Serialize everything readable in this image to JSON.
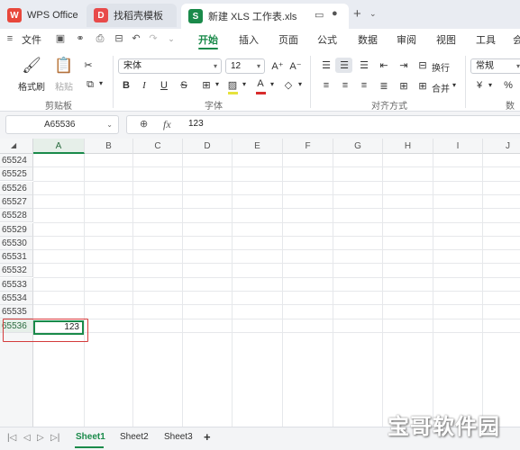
{
  "window": {
    "tabs": [
      {
        "label": "WPS Office",
        "icon": "wps-logo-icon"
      },
      {
        "label": "找稻壳模板",
        "icon": "docer-icon"
      },
      {
        "label": "新建 XLS 工作表.xls",
        "icon": "spreadsheet-icon"
      }
    ],
    "new_tab_symbol": "+"
  },
  "menu": {
    "file_label": "文件",
    "items": [
      "开始",
      "插入",
      "页面",
      "公式",
      "数据",
      "审阅",
      "视图",
      "工具",
      "会"
    ],
    "active": "开始"
  },
  "ribbon": {
    "clipboard": {
      "format_painter": "格式刷",
      "paste": "粘贴",
      "group_label": "剪贴板"
    },
    "font": {
      "name": "宋体",
      "size": "12",
      "group_label": "字体"
    },
    "alignment": {
      "wrap": "换行",
      "merge": "合并",
      "group_label": "对齐方式"
    },
    "number": {
      "format": "常规",
      "group_label": "数字",
      "currency_symbol": "¥",
      "percent_symbol": "%"
    }
  },
  "formula_bar": {
    "name_box": "A65536",
    "fx_label": "fx",
    "value": "123"
  },
  "grid": {
    "columns": [
      "A",
      "B",
      "C",
      "D",
      "E",
      "F",
      "G",
      "H",
      "I",
      "J"
    ],
    "selected_column": "A",
    "rows": [
      "65524",
      "65525",
      "65526",
      "65527",
      "65528",
      "65529",
      "65530",
      "65531",
      "65532",
      "65533",
      "65534",
      "65535",
      "65536"
    ],
    "selected_row": "65536",
    "active_cell_value": "123"
  },
  "sheets": {
    "tabs": [
      "Sheet1",
      "Sheet2",
      "Sheet3"
    ],
    "active": "Sheet1",
    "add_symbol": "+"
  },
  "watermark": "宝哥软件园",
  "colors": {
    "accent": "#1a8a4a",
    "highlight_box": "#d43b3b"
  }
}
